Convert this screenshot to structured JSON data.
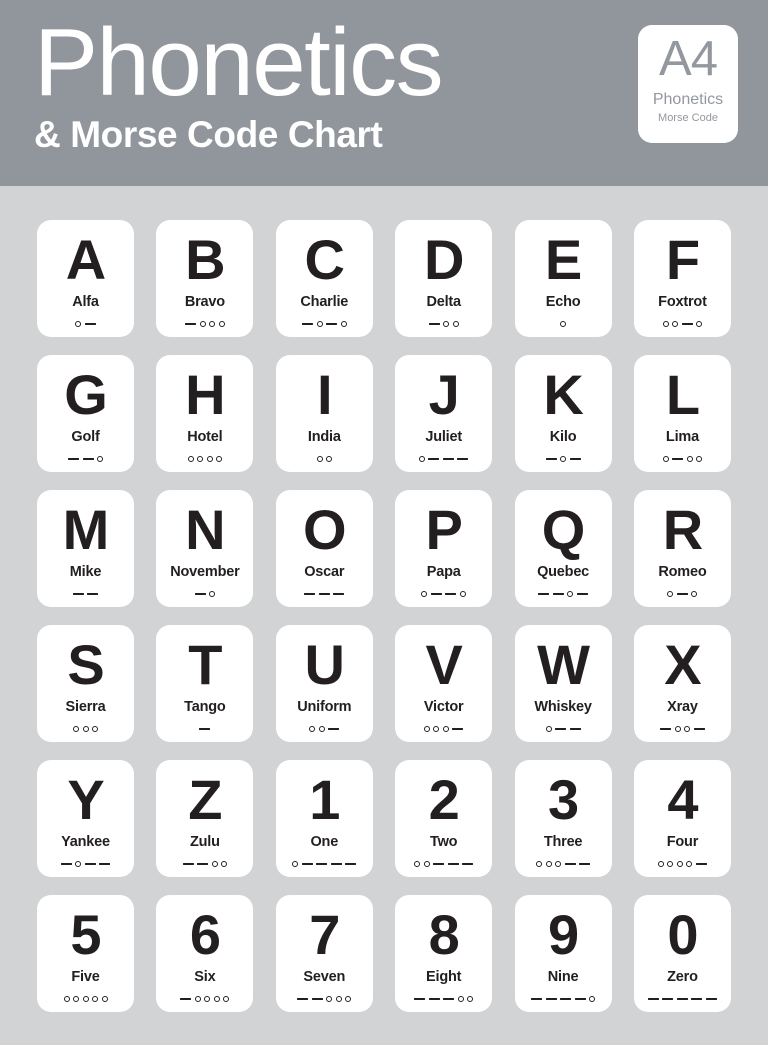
{
  "header": {
    "title_main": "Phonetics",
    "title_sub": "& Morse Code Chart",
    "background_color": "#91959c",
    "title_color": "#ffffff"
  },
  "badge": {
    "code": "A4",
    "line1": "Phonetics",
    "line2": "Morse Code",
    "text_color": "#93979e",
    "background_color": "#ffffff"
  },
  "page": {
    "background_color": "#d2d3d5",
    "card_color": "#ffffff",
    "ink_color": "#231f20"
  },
  "legend": {
    "dot_symbol": "o",
    "dash_symbol": "-"
  },
  "cards": [
    {
      "letter": "A",
      "word": "Alfa",
      "morse": ".-"
    },
    {
      "letter": "B",
      "word": "Bravo",
      "morse": "-..."
    },
    {
      "letter": "C",
      "word": "Charlie",
      "morse": "-.-."
    },
    {
      "letter": "D",
      "word": "Delta",
      "morse": "-.."
    },
    {
      "letter": "E",
      "word": "Echo",
      "morse": "."
    },
    {
      "letter": "F",
      "word": "Foxtrot",
      "morse": "..-."
    },
    {
      "letter": "G",
      "word": "Golf",
      "morse": "--."
    },
    {
      "letter": "H",
      "word": "Hotel",
      "morse": "...."
    },
    {
      "letter": "I",
      "word": "India",
      "morse": ".."
    },
    {
      "letter": "J",
      "word": "Juliet",
      "morse": ".---"
    },
    {
      "letter": "K",
      "word": "Kilo",
      "morse": "-.-"
    },
    {
      "letter": "L",
      "word": "Lima",
      "morse": ".-.."
    },
    {
      "letter": "M",
      "word": "Mike",
      "morse": "--"
    },
    {
      "letter": "N",
      "word": "November",
      "morse": "-."
    },
    {
      "letter": "O",
      "word": "Oscar",
      "morse": "---"
    },
    {
      "letter": "P",
      "word": "Papa",
      "morse": ".--."
    },
    {
      "letter": "Q",
      "word": "Quebec",
      "morse": "--.-"
    },
    {
      "letter": "R",
      "word": "Romeo",
      "morse": ".-."
    },
    {
      "letter": "S",
      "word": "Sierra",
      "morse": "..."
    },
    {
      "letter": "T",
      "word": "Tango",
      "morse": "-"
    },
    {
      "letter": "U",
      "word": "Uniform",
      "morse": "..-"
    },
    {
      "letter": "V",
      "word": "Victor",
      "morse": "...-"
    },
    {
      "letter": "W",
      "word": "Whiskey",
      "morse": ".--"
    },
    {
      "letter": "X",
      "word": "Xray",
      "morse": "-..-"
    },
    {
      "letter": "Y",
      "word": "Yankee",
      "morse": "-.--"
    },
    {
      "letter": "Z",
      "word": "Zulu",
      "morse": "--.."
    },
    {
      "letter": "1",
      "word": "One",
      "morse": ".----"
    },
    {
      "letter": "2",
      "word": "Two",
      "morse": "..---"
    },
    {
      "letter": "3",
      "word": "Three",
      "morse": "...--"
    },
    {
      "letter": "4",
      "word": "Four",
      "morse": "....-"
    },
    {
      "letter": "5",
      "word": "Five",
      "morse": "....."
    },
    {
      "letter": "6",
      "word": "Six",
      "morse": "-...."
    },
    {
      "letter": "7",
      "word": "Seven",
      "morse": "--..."
    },
    {
      "letter": "8",
      "word": "Eight",
      "morse": "---.."
    },
    {
      "letter": "9",
      "word": "Nine",
      "morse": "----."
    },
    {
      "letter": "0",
      "word": "Zero",
      "morse": "-----"
    }
  ]
}
